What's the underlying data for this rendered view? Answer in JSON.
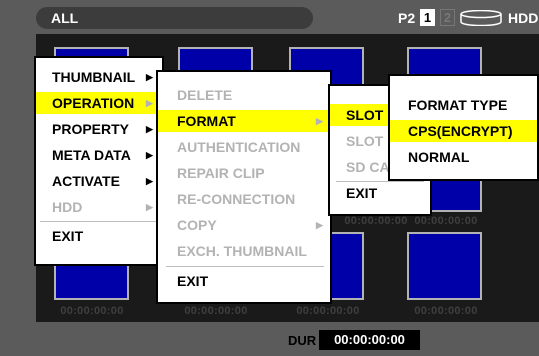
{
  "header": {
    "tab_label": "ALL",
    "p2_label": "P2",
    "slot1_label": "1",
    "slot2_label": "2",
    "hdd_label": "HDD",
    "disk_icon": "hdd-icon"
  },
  "thumbnails": {
    "timecode": "00:00:00:00"
  },
  "footer": {
    "dur_label": "DUR",
    "dur_value": "00:00:00:00"
  },
  "menu1": {
    "items": [
      {
        "label": "THUMBNAIL"
      },
      {
        "label": "OPERATION"
      },
      {
        "label": "PROPERTY"
      },
      {
        "label": "META DATA"
      },
      {
        "label": "ACTIVATE"
      },
      {
        "label": "HDD"
      },
      {
        "label": "EXIT"
      }
    ]
  },
  "menu2": {
    "items": [
      {
        "label": "DELETE"
      },
      {
        "label": "FORMAT"
      },
      {
        "label": "AUTHENTICATION"
      },
      {
        "label": "REPAIR CLIP"
      },
      {
        "label": "RE-CONNECTION"
      },
      {
        "label": "COPY"
      },
      {
        "label": "EXCH. THUMBNAIL"
      },
      {
        "label": "EXIT"
      }
    ]
  },
  "menu3": {
    "items": [
      {
        "label": "SLOT"
      },
      {
        "label": "SLOT"
      },
      {
        "label": "SD CA"
      },
      {
        "label": "EXIT"
      }
    ]
  },
  "menu4": {
    "items": [
      {
        "label": "FORMAT TYPE"
      },
      {
        "label": "CPS(ENCRYPT)"
      },
      {
        "label": "NORMAL"
      }
    ]
  },
  "colors": {
    "highlight": "#ffff00",
    "thumbnail": "#0000a8",
    "disabled_text": "#b3b3b3"
  }
}
